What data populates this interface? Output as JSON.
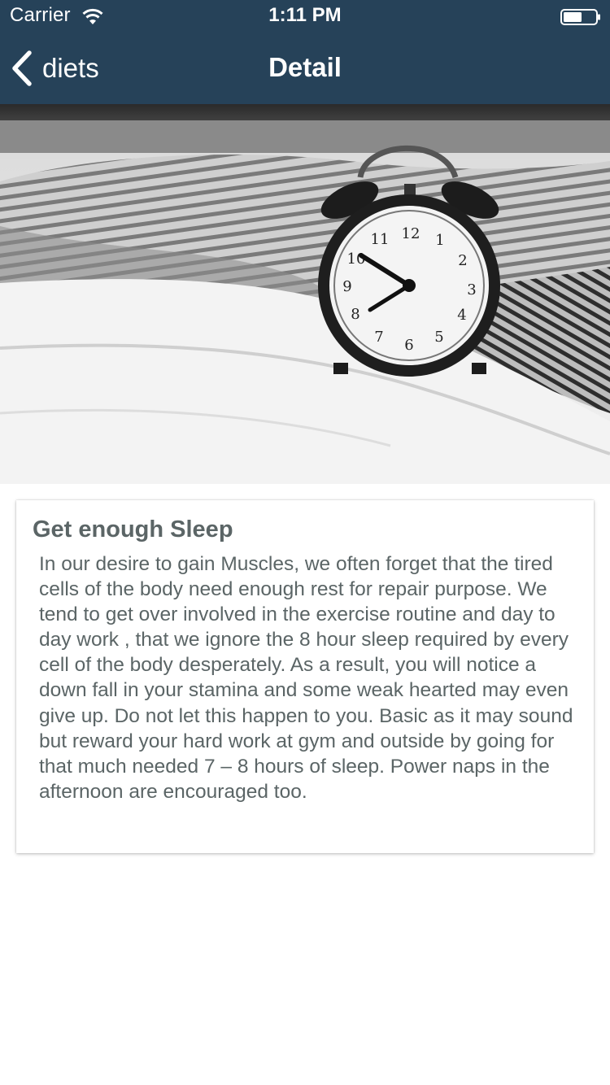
{
  "status_bar": {
    "carrier": "Carrier",
    "time": "1:11 PM"
  },
  "nav": {
    "back_label": "diets",
    "title": "Detail"
  },
  "hero": {
    "alt": "Alarm clock on a bed with pillows",
    "icon": "alarm-clock-photo"
  },
  "card": {
    "title": "Get enough Sleep",
    "body": "In our desire to gain Muscles, we often forget that the tired cells of the body need enough rest for repair purpose. We tend to get over involved in the exercise routine and day to day work , that we ignore the 8 hour sleep required by every cell of the body desperately. As a result, you will notice a down fall in your stamina and some weak hearted may even give up. Do not let this happen to you. Basic as it may sound but reward your hard work at gym and outside by going for that much needed 7 – 8 hours of sleep. Power naps in the afternoon are encouraged too."
  },
  "colors": {
    "header_bg": "#264259",
    "text": "#5b6566"
  }
}
